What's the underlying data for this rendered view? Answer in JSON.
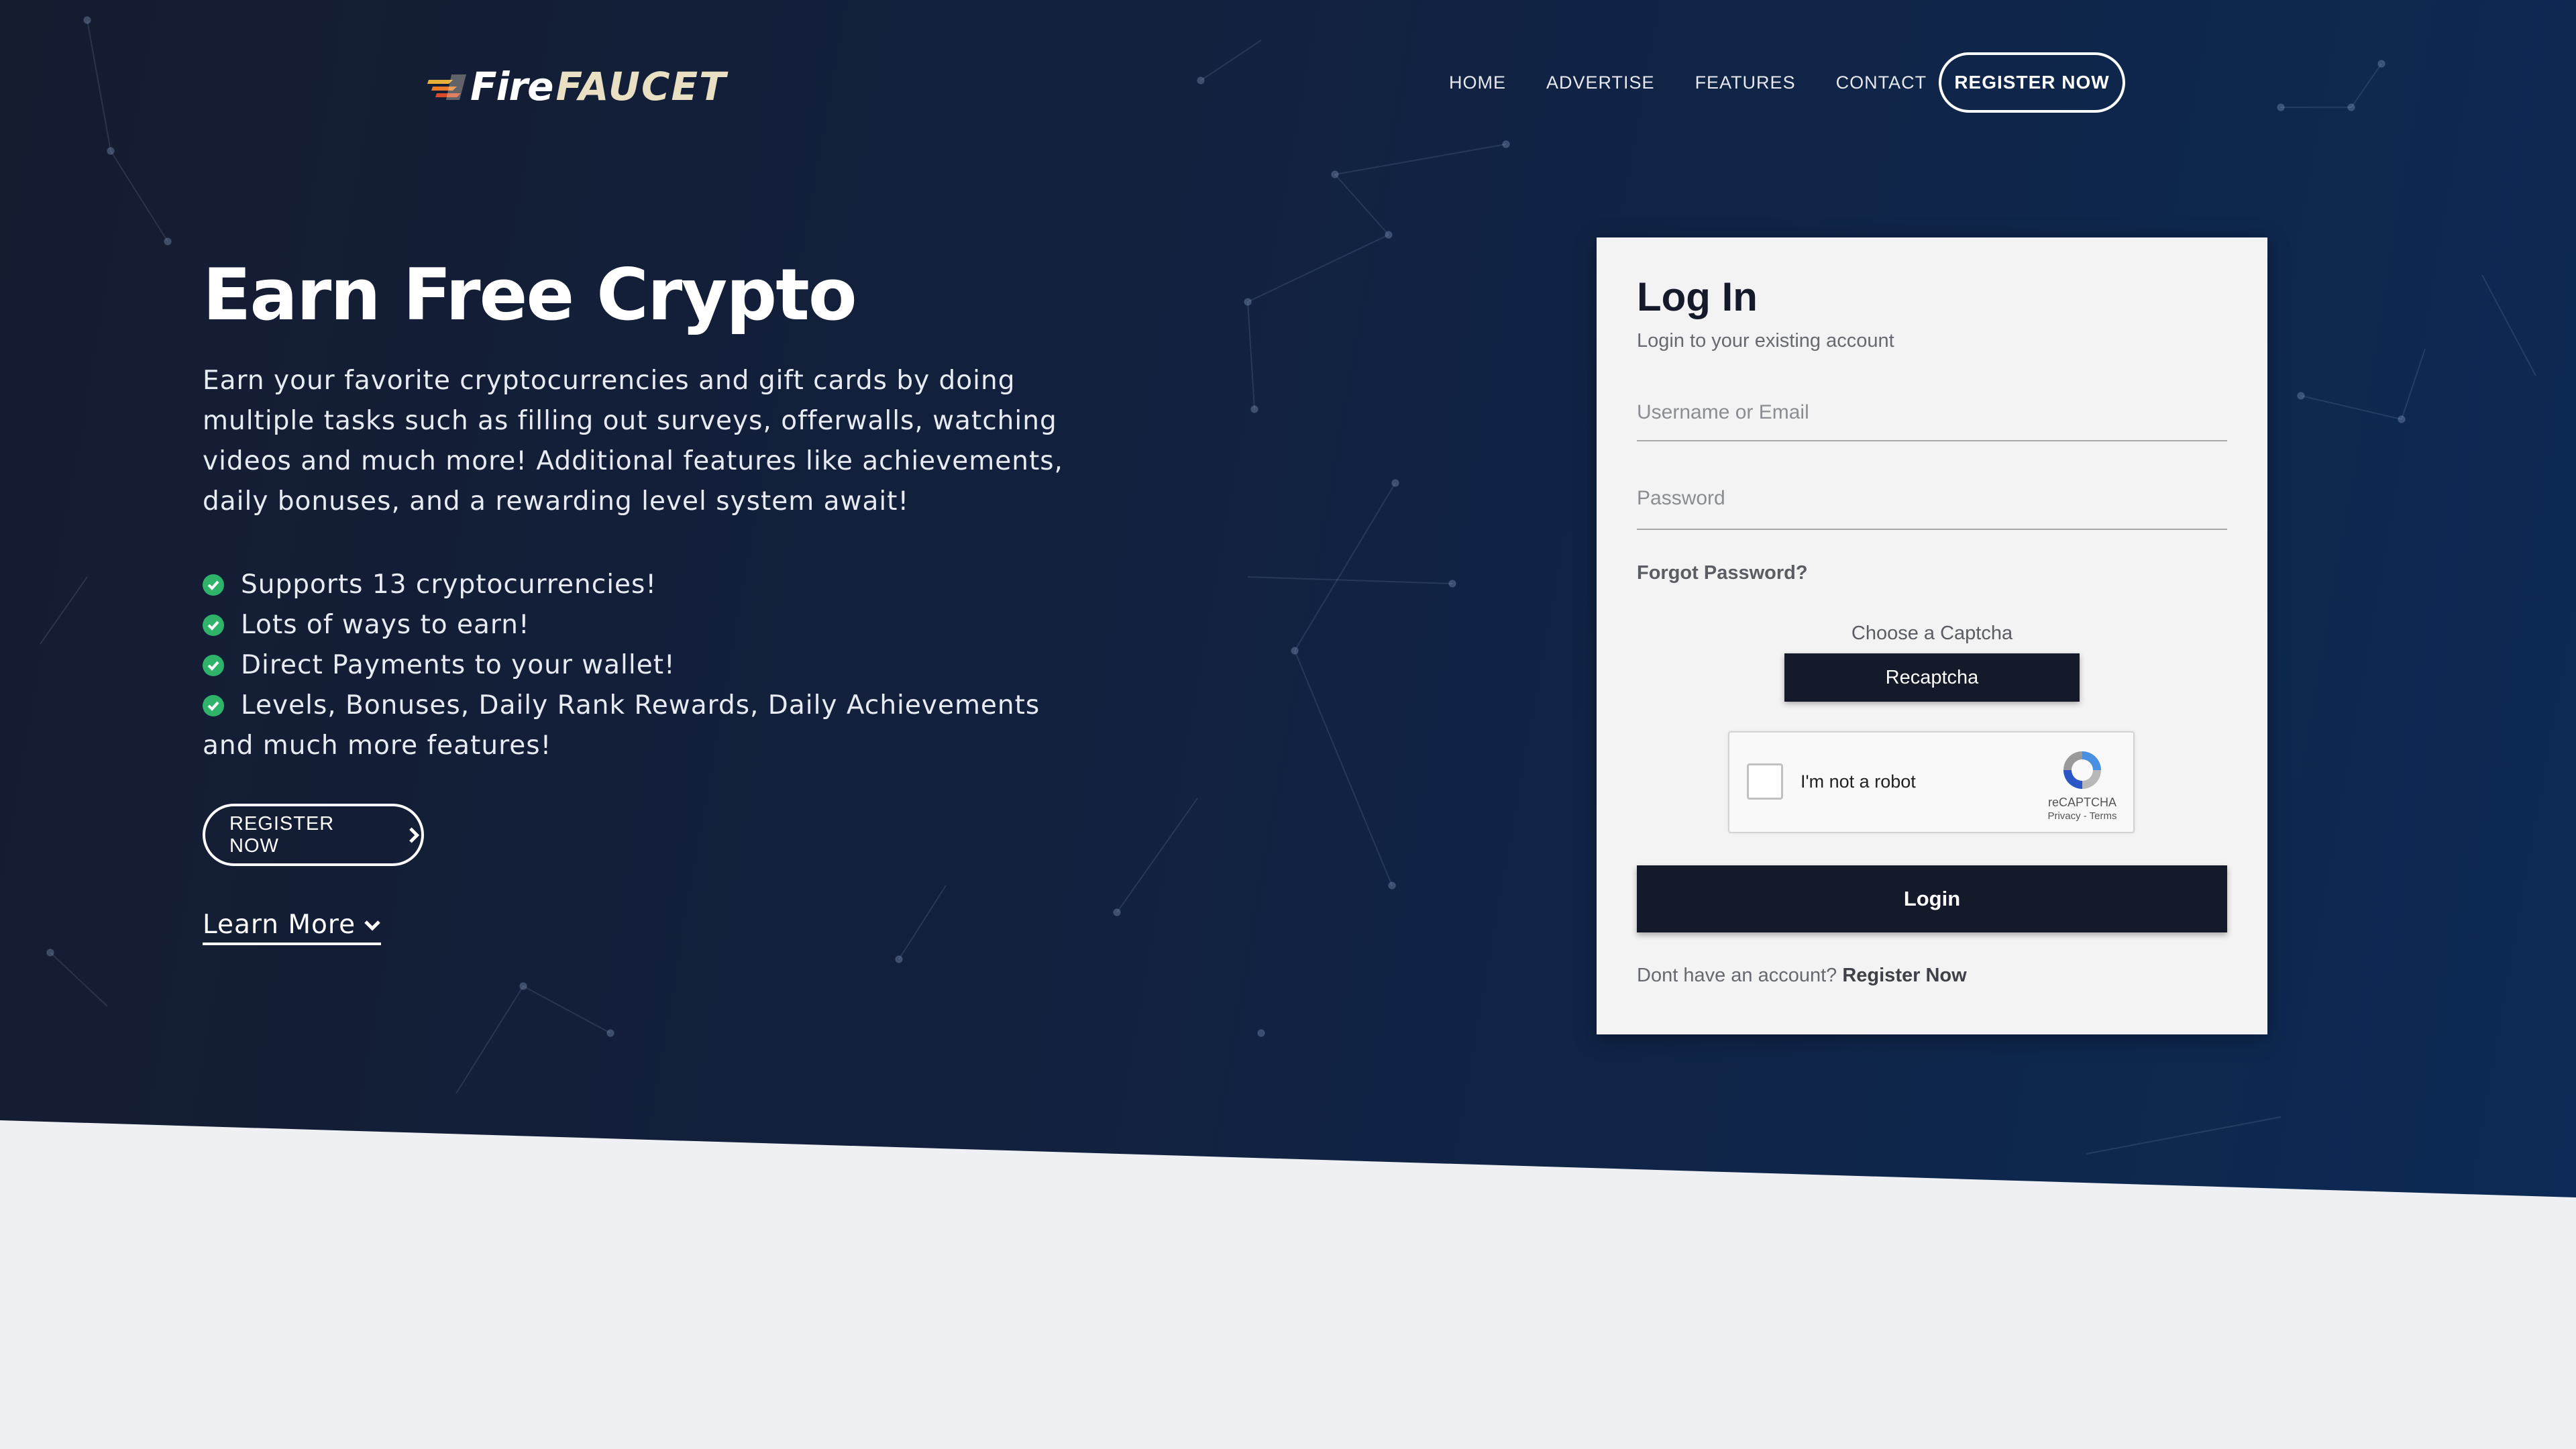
{
  "brand": {
    "fire": "Fire",
    "faucet": "FAUCET"
  },
  "nav": {
    "items": [
      "HOME",
      "ADVERTISE",
      "FEATURES",
      "CONTACT"
    ],
    "register": "REGISTER NOW"
  },
  "hero": {
    "title": "Earn Free Crypto",
    "intro": "Earn your favorite cryptocurrencies and gift cards by doing multiple tasks such as filling out surveys, offerwalls, watching videos and much more! Additional features like achievements, daily bonuses, and a rewarding level system await!",
    "features": [
      "Supports 13 cryptocurrencies!",
      "Lots of ways to earn!",
      "Direct Payments to your wallet!",
      "Levels, Bonuses, Daily Rank Rewards, Daily Achievements and much more features!"
    ],
    "register_button": "REGISTER NOW",
    "learn_more": "Learn More"
  },
  "login": {
    "title": "Log In",
    "subtitle": "Login to your existing account",
    "username_placeholder": "Username or Email",
    "password_placeholder": "Password",
    "forgot": "Forgot Password?",
    "captcha_label": "Choose a Captcha",
    "captcha_choice": "Recaptcha",
    "recaptcha": {
      "label": "I'm not a robot",
      "brand": "reCAPTCHA",
      "links": "Privacy - Terms"
    },
    "login_button": "Login",
    "no_account": "Dont have an account?",
    "register_link": "Register Now"
  },
  "colors": {
    "hero_dark": "#141c30",
    "hero_blue": "#0c2a55",
    "card_bg": "#f3f3f3",
    "button_dark": "#141a2a",
    "check_green": "#2fb36b"
  }
}
